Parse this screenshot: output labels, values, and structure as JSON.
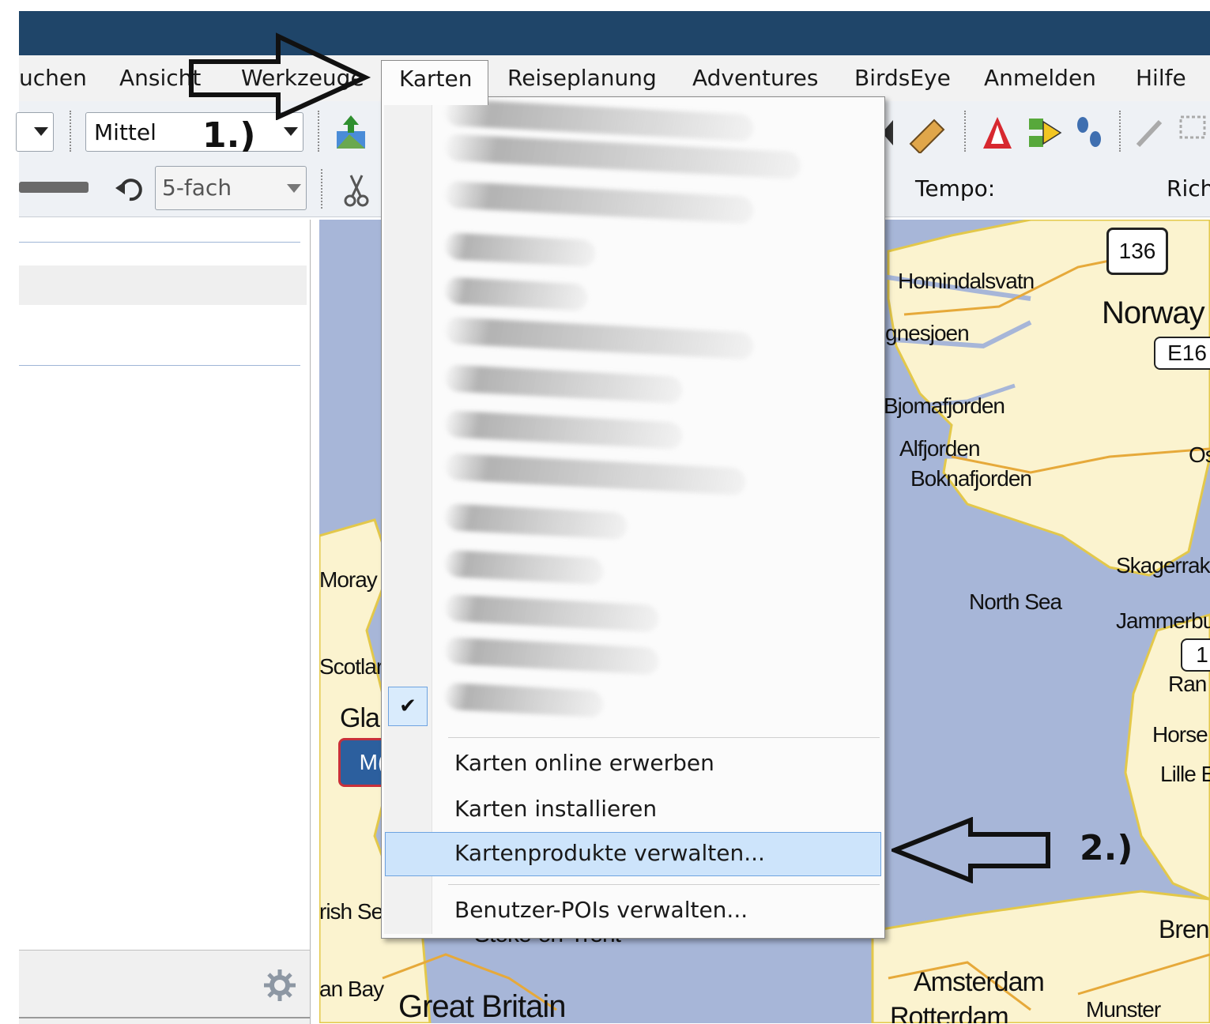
{
  "menubar": {
    "items": [
      "uchen",
      "Ansicht",
      "Werkzeuge",
      "Karten",
      "Reiseplanung",
      "Adventures",
      "BirdsEye",
      "Anmelden",
      "Hilfe"
    ]
  },
  "toolbar": {
    "detail_combo": "Mittel",
    "zoom_combo": "5-fach",
    "tempo_label": "Tempo:",
    "richtung_label": "Rich"
  },
  "annotations": {
    "step1": "1.)",
    "step2": "2.)"
  },
  "dropdown": {
    "checked_item_index": 12,
    "blurred_entries_count": 13,
    "items": [
      "Karten online erwerben",
      "Karten installieren",
      "Kartenprodukte verwalten...",
      "Benutzer-POIs verwalten..."
    ],
    "highlighted": "Kartenprodukte verwalten..."
  },
  "map": {
    "labels": [
      "Homindalsvatn",
      "Norway",
      "gnesjoen",
      "Bjomafjorden",
      "Alfjorden",
      "Boknafjorden",
      "Os",
      "Skagerrak",
      "North Sea",
      "Jammerbu",
      "Ran",
      "Horse",
      "Lille E",
      "Moray",
      "Scotlar",
      "Gla",
      "rish Se",
      "an Bay",
      "Stoke-on-Trent",
      "Great Britain",
      "Amsterdam",
      "Rotterdam",
      "Munster",
      "Bren"
    ],
    "shields": [
      "136",
      "E16",
      "1",
      "M("
    ]
  },
  "colors": {
    "titlebar": "#1f4569",
    "water": "#a7b6d8",
    "land": "#fbf3cf",
    "highlight": "#cde4fb"
  }
}
